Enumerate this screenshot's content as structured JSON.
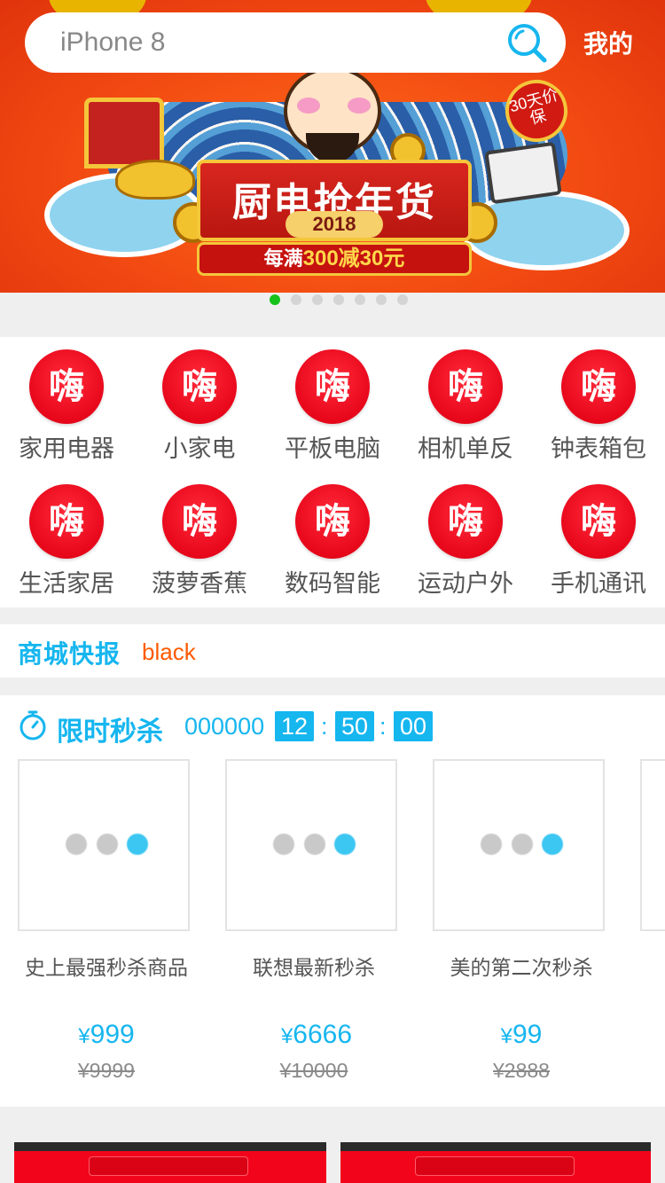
{
  "search": {
    "placeholder": "iPhone 8"
  },
  "header": {
    "mine_label": "我的"
  },
  "banner": {
    "title": "厨电抢年货",
    "year": "2018",
    "promo_prefix": "每满",
    "promo_highlight": "300减30元",
    "badge": "30天价保",
    "slide_count": 7,
    "active_slide": 1
  },
  "categories": [
    {
      "icon_text": "嗨",
      "label": "家用电器"
    },
    {
      "icon_text": "嗨",
      "label": "小家电"
    },
    {
      "icon_text": "嗨",
      "label": "平板电脑"
    },
    {
      "icon_text": "嗨",
      "label": "相机单反"
    },
    {
      "icon_text": "嗨",
      "label": "钟表箱包"
    },
    {
      "icon_text": "嗨",
      "label": "生活家居"
    },
    {
      "icon_text": "嗨",
      "label": "菠萝香蕉"
    },
    {
      "icon_text": "嗨",
      "label": "数码智能"
    },
    {
      "icon_text": "嗨",
      "label": "运动户外"
    },
    {
      "icon_text": "嗨",
      "label": "手机通讯"
    }
  ],
  "news": {
    "brand": "商城快报",
    "message": "black"
  },
  "flash_sale": {
    "title": "限时秒杀",
    "prefix": "000000",
    "hours": "12",
    "minutes": "50",
    "seconds": "00",
    "products": [
      {
        "name": "史上最强秒杀商品",
        "price": "999",
        "original_price": "¥9999"
      },
      {
        "name": "联想最新秒杀",
        "price": "6666",
        "original_price": "¥10000"
      },
      {
        "name": "美的第二次秒杀",
        "price": "99",
        "original_price": "¥2888"
      }
    ],
    "currency": "¥"
  },
  "colors": {
    "accent": "#16b6ef",
    "brand_red": "#e8071b",
    "news_orange": "#ff5a00",
    "dot_active": "#16c21a"
  }
}
